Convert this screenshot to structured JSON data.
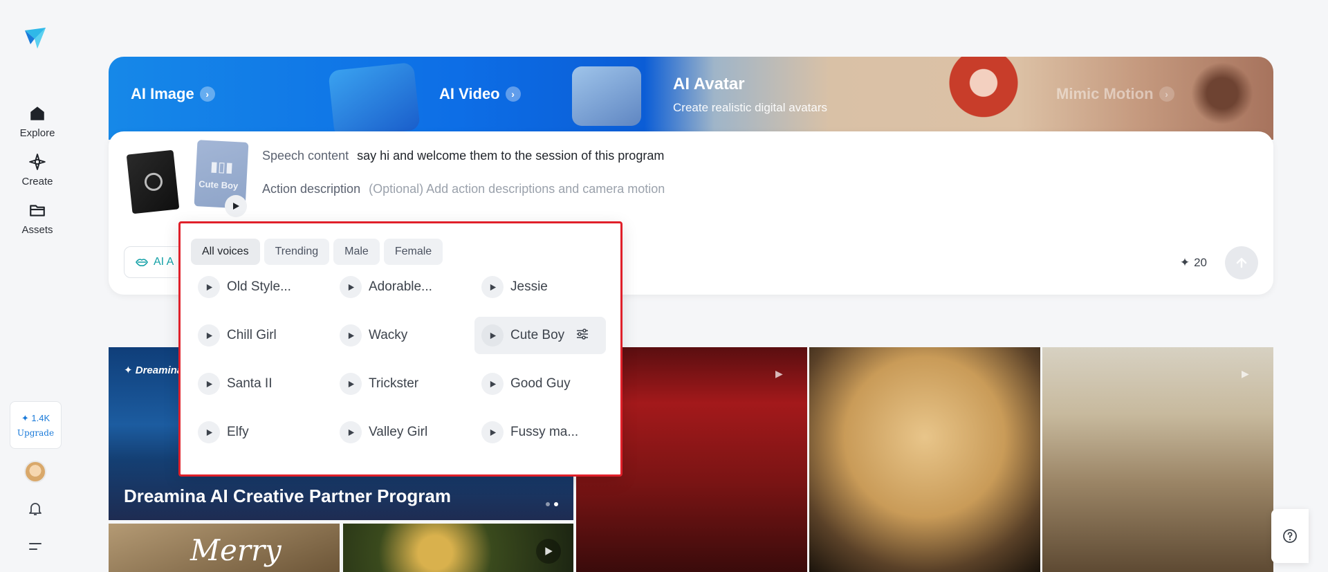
{
  "nav": {
    "items": [
      {
        "label": "Explore",
        "icon": "home-icon"
      },
      {
        "label": "Create",
        "icon": "sparkle-icon"
      },
      {
        "label": "Assets",
        "icon": "folder-icon"
      }
    ],
    "credits": "1.4K",
    "upgrade": "Upgrade"
  },
  "banner": {
    "ai_image": "AI Image",
    "ai_video": "AI Video",
    "ai_avatar": "AI Avatar",
    "ai_avatar_sub": "Create realistic digital avatars",
    "mimic_motion": "Mimic Motion"
  },
  "prompt": {
    "voice_name": "Cute Boy",
    "speech_label": "Speech content",
    "speech_value": "say hi and welcome them to the session of this program",
    "action_label": "Action description",
    "action_placeholder": "(Optional) Add action descriptions and camera motion",
    "mode_label": "AI A",
    "cost": "20"
  },
  "voice_picker": {
    "filters": [
      "All voices",
      "Trending",
      "Male",
      "Female"
    ],
    "active_filter": "All voices",
    "voices": [
      "Old Style...",
      "Adorable...",
      "Jessie",
      "Chill Girl",
      "Wacky",
      "Cute Boy",
      "Santa II",
      "Trickster",
      "Good Guy",
      "Elfy",
      "Valley Girl",
      "Fussy ma..."
    ],
    "selected_voice": "Cute Boy"
  },
  "gallery": {
    "brand": "Dreamina",
    "hero_title": "Dreamina AI Creative Partner Program",
    "merry": "Merry"
  },
  "colors": {
    "accent": "#1a7ad9",
    "highlight_border": "#e0202a",
    "mode_teal": "#14a1a7"
  }
}
